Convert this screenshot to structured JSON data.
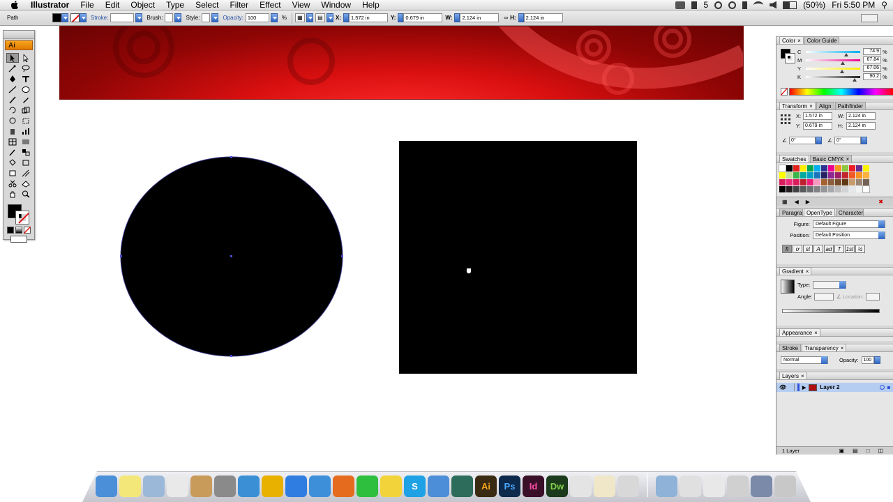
{
  "menubar": {
    "app_name": "Illustrator",
    "menus": [
      "File",
      "Edit",
      "Object",
      "Type",
      "Select",
      "Filter",
      "Effect",
      "View",
      "Window",
      "Help"
    ],
    "status": {
      "adobe_count": "5",
      "battery": "(50%)",
      "clock": "Fri 5:50 PM"
    }
  },
  "controlbar": {
    "selection_type": "Path",
    "stroke_label": "Stroke:",
    "brush_label": "Brush:",
    "style_label": "Style:",
    "opacity_label": "Opacity:",
    "opacity_value": "100",
    "percent": "%",
    "x_label": "X:",
    "x_value": "1.572 in",
    "y_label": "Y:",
    "y_value": "0.679 in",
    "w_label": "W:",
    "w_value": "2.124 in",
    "h_label": "H:",
    "h_value": "2.124 in"
  },
  "tools_panel": {
    "logo": "Ai"
  },
  "color_panel": {
    "tabs": [
      "Color",
      "Color Guide"
    ],
    "channels": [
      {
        "label": "C",
        "value": "74.9",
        "pct": 0.749
      },
      {
        "label": "M",
        "value": "67.84",
        "pct": 0.678
      },
      {
        "label": "Y",
        "value": "67.06",
        "pct": 0.671
      },
      {
        "label": "K",
        "value": "90.2",
        "pct": 0.902
      }
    ]
  },
  "transform_panel": {
    "tabs": [
      "Transform",
      "Align",
      "Pathfinder"
    ],
    "x_label": "X:",
    "x": "1.572 in",
    "y_label": "Y:",
    "y": "0.679 in",
    "w_label": "W:",
    "w": "2.124 in",
    "h_label": "H:",
    "h": "2.124 in",
    "rotate": "0°",
    "shear": "0°"
  },
  "swatches_panel": {
    "tabs": [
      "Swatches",
      "Basic CMYK"
    ],
    "colors": [
      "#ffffff",
      "#000000",
      "#e2231a",
      "#ffed00",
      "#00a651",
      "#00aeef",
      "#2e3192",
      "#ec008c",
      "#f7941d",
      "#8dc63f",
      "#ed1c24",
      "#662d91",
      "#fff200",
      "#ffff00",
      "#c4df9b",
      "#39b54a",
      "#00a99d",
      "#00a0c6",
      "#1b75bc",
      "#262262",
      "#8e278f",
      "#9e1f63",
      "#c2272d",
      "#f15a24",
      "#f7931e",
      "#fbb040",
      "#d91c5c",
      "#ee2a7b",
      "#da1c5c",
      "#be1e2d",
      "#ed1e79",
      "#f49ac1",
      "#a3612f",
      "#8b5e3c",
      "#754c29",
      "#603813",
      "#c69c6d",
      "#998675",
      "#736357",
      "#000000",
      "#231f20",
      "#414042",
      "#58595b",
      "#6d6e71",
      "#808285",
      "#939598",
      "#a7a9ac",
      "#bcbec0",
      "#d1d3d4",
      "#e6e7e8",
      "#f1f2f2",
      "#ffffff"
    ]
  },
  "opentype_panel": {
    "tabs": [
      "Paragraph",
      "OpenType",
      "Character"
    ],
    "figure_label": "Figure:",
    "figure_value": "Default Figure",
    "position_label": "Position:",
    "position_value": "Default Position",
    "buttons": [
      "fi",
      "ơ",
      "st",
      "A",
      "ad",
      "T",
      "1st",
      "½"
    ]
  },
  "gradient_panel": {
    "tab": "Gradient",
    "type_label": "Type:",
    "angle_label": "Angle:",
    "location_label": "Location:"
  },
  "appearance_panel": {
    "tab": "Appearance"
  },
  "transparency_panel": {
    "tabs": [
      "Stroke",
      "Transparency"
    ],
    "blend_mode": "Normal",
    "opacity_label": "Opacity:",
    "opacity_value": "100"
  },
  "layers_panel": {
    "tab": "Layers",
    "layer_name": "Layer 2",
    "footer": "1 Layer"
  },
  "dock": {
    "apps": [
      {
        "name": "finder",
        "label": "",
        "bg": "#4a8fd8"
      },
      {
        "name": "stickies",
        "label": "",
        "bg": "#f3e77a"
      },
      {
        "name": "preview",
        "label": "",
        "bg": "#9bb8d8"
      },
      {
        "name": "textedit",
        "label": "",
        "bg": "#e9e9e9"
      },
      {
        "name": "iphoto",
        "label": "",
        "bg": "#c99b5b"
      },
      {
        "name": "imovie",
        "label": "",
        "bg": "#8a8a8a"
      },
      {
        "name": "mail",
        "label": "",
        "bg": "#3a8fd5"
      },
      {
        "name": "transmit",
        "label": "",
        "bg": "#e8b100"
      },
      {
        "name": "itunes",
        "label": "",
        "bg": "#2f7de1"
      },
      {
        "name": "safari",
        "label": "",
        "bg": "#3e8fd9"
      },
      {
        "name": "firefox",
        "label": "",
        "bg": "#e56b1f"
      },
      {
        "name": "numbers",
        "label": "",
        "bg": "#2fbf3f"
      },
      {
        "name": "cyberduck",
        "label": "",
        "bg": "#f2d43a"
      },
      {
        "name": "skype",
        "label": "S",
        "bg": "#1fa2e5"
      },
      {
        "name": "ichat",
        "label": "",
        "bg": "#4c8ed8"
      },
      {
        "name": "timemachine",
        "label": "",
        "bg": "#2d6c5a"
      },
      {
        "name": "illustrator",
        "label": "Ai",
        "bg": "#3a2a12"
      },
      {
        "name": "photoshop",
        "label": "Ps",
        "bg": "#0d2a4c"
      },
      {
        "name": "indesign",
        "label": "Id",
        "bg": "#3a0f28"
      },
      {
        "name": "dreamweaver",
        "label": "Dw",
        "bg": "#1c3a1c"
      },
      {
        "name": "acrobat",
        "label": "",
        "bg": "#e4e4e4"
      },
      {
        "name": "twitter",
        "label": "",
        "bg": "#f0e7c8"
      },
      {
        "name": "misc-app",
        "label": "",
        "bg": "#d8d8d8"
      },
      {
        "name": "applications-folder",
        "label": "",
        "bg": "#8fb2d8"
      },
      {
        "name": "documents-stack",
        "label": "",
        "bg": "#e0e0e0"
      },
      {
        "name": "downloads-stack",
        "label": "",
        "bg": "#e8e8e8"
      },
      {
        "name": "screenshot-stack",
        "label": "",
        "bg": "#d0d0d0"
      },
      {
        "name": "display-stack",
        "label": "",
        "bg": "#7a8aa8"
      },
      {
        "name": "trash",
        "label": "",
        "bg": "#c8c8c8"
      }
    ]
  }
}
